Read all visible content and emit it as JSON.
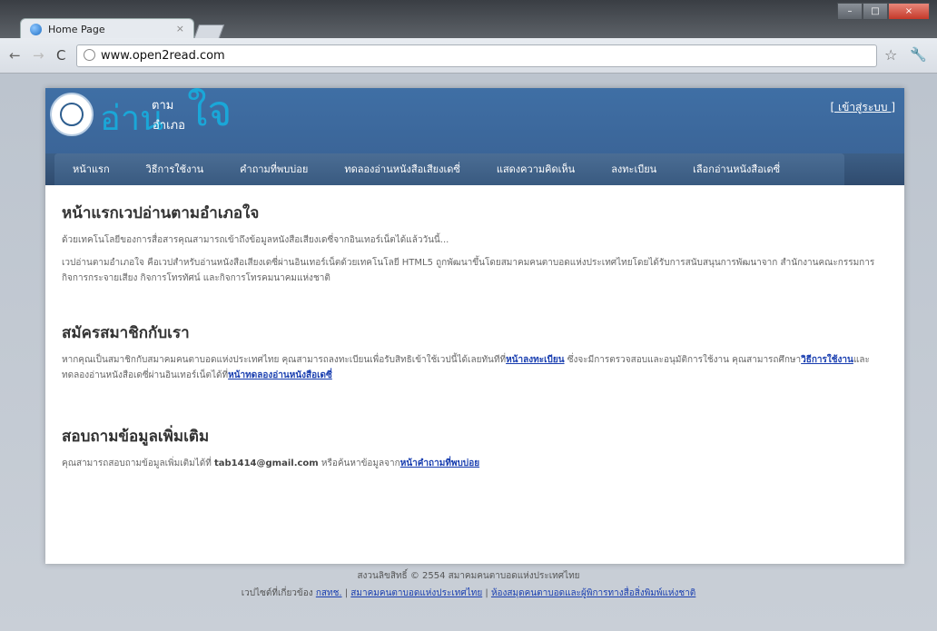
{
  "browser": {
    "tab_title": "Home Page",
    "tab_close": "×",
    "url": "www.open2read.com",
    "window_controls": [
      "–",
      "□",
      "×"
    ]
  },
  "site": {
    "logo_main": "อ่าน",
    "logo_top": "ตาม",
    "logo_bottom": "อำเภอ",
    "logo_big": "ใจ",
    "login_link": "[ เข้าสู่ระบบ ]"
  },
  "menu": [
    "หน้าแรก",
    "วิธีการใช้งาน",
    "คำถามที่พบบ่อย",
    "ทดลองอ่านหนังสือเสียงเดซี่",
    "แสดงความคิดเห็น",
    "ลงทะเบียน",
    "เลือกอ่านหนังสือเดซี่"
  ],
  "sections": {
    "intro": {
      "title": "หน้าแรกเวปอ่านตามอำเภอใจ",
      "p1": "ด้วยเทคโนโลยีของการสื่อสารคุณสามารถเข้าถึงข้อมูลหนังสือเสียงเดซี่จากอินเทอร์เน็ตได้แล้ววันนี้...",
      "p2": "เวปอ่านตามอำเภอใจ คือเวปสำหรับอ่านหนังสือเสียงเดซี่ผ่านอินเทอร์เน็ตด้วยเทคโนโลยี HTML5 ถูกพัฒนาขึ้นโดยสมาคมคนตาบอดแห่งประเทศไทยโดยได้รับการสนับสนุนการพัฒนาจาก สำนักงานคณะกรรมการกิจการกระจายเสียง กิจการโทรทัศน์ และกิจการโทรคมนาคมแห่งชาติ"
    },
    "signup": {
      "title": "สมัครสมาชิกกับเรา",
      "text_before": "หากคุณเป็นสมาชิกกับสมาคมคนตาบอดแห่งประเทศไทย คุณสามารถลงทะเบียนเพื่อรับสิทธิเข้าใช้เวปนี้ได้เลยทันทีที่",
      "link1": "หน้าลงทะเบียน",
      "text_mid1": " ซึ่งจะมีการตรวจสอบและอนุมัติการใช้งาน คุณสามารถศึกษา",
      "link2": "วิธีการใช้งาน",
      "text_mid2": "และทดลองอ่านหนังสือเดซี่ผ่านอินเทอร์เน็ตได้ที่",
      "link3": "หน้าทดลองอ่านหนังสือเดซี่"
    },
    "contact": {
      "title": "สอบถามข้อมูลเพิ่มเติม",
      "text_before": "คุณสามารถสอบถามข้อมูลเพิ่มเติมได้ที่ ",
      "email": "tab1414@gmail.com",
      "text_after": " หรือค้นหาข้อมูลจาก",
      "link": "หน้าคำถามที่พบบ่อย"
    }
  },
  "footer": {
    "line1": "สงวนลิขสิทธิ์ © 2554 สมาคมคนตาบอดแห่งประเทศไทย",
    "line2_prefix": "เวปไซต์ที่เกี่ยวข้อง ",
    "links": [
      "กสทช.",
      "สมาคมคนตาบอดแห่งประเทศไทย",
      "ห้องสมุดคนตาบอดและผู้พิการทางสื่อสิ่งพิมพ์แห่งชาติ"
    ],
    "sep": " | "
  }
}
